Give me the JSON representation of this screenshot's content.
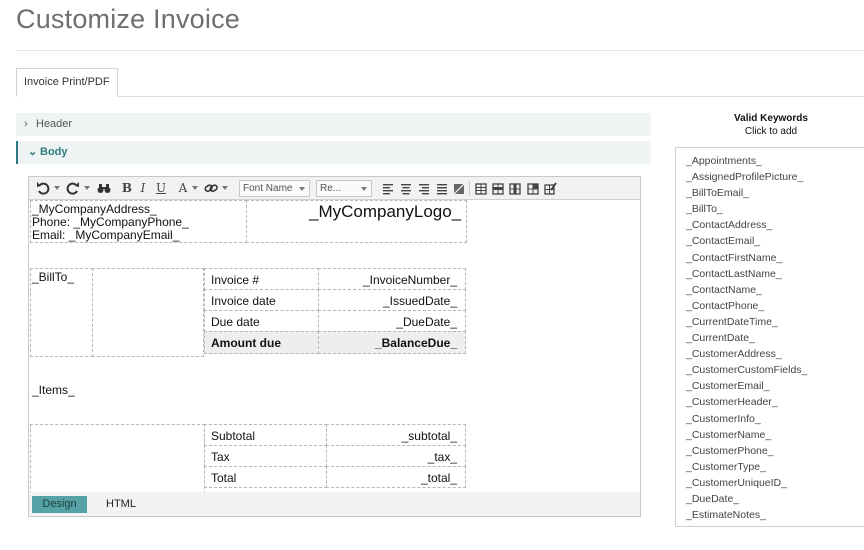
{
  "page": {
    "title": "Customize Invoice"
  },
  "tabs": [
    {
      "label": "Invoice Print/PDF"
    }
  ],
  "sections": {
    "header": "Header",
    "body": "Body"
  },
  "toolbar": {
    "font_name": "Font Name",
    "font_size": "Re..."
  },
  "template": {
    "company_block": [
      "_MyCompanyAddress_",
      "Phone: _MyCompanyPhone_",
      "Email: _MyCompanyEmail_"
    ],
    "logo": "_MyCompanyLogo_",
    "bill_to": "_BillTo_",
    "invoice_rows": [
      {
        "label": "Invoice #",
        "value": "_InvoiceNumber_"
      },
      {
        "label": "Invoice date",
        "value": "_IssuedDate_"
      },
      {
        "label": "Due date",
        "value": "_DueDate_"
      },
      {
        "label": "Amount due",
        "value": "_BalanceDue_"
      }
    ],
    "items": "_Items_",
    "totals_rows": [
      {
        "label": "Subtotal",
        "value": "_subtotal_"
      },
      {
        "label": "Tax",
        "value": "_tax_"
      },
      {
        "label": "Total",
        "value": "_total_"
      }
    ]
  },
  "editor_tabs": {
    "design": "Design",
    "html": "HTML"
  },
  "keywords": {
    "title": "Valid Keywords",
    "subtitle": "Click to add",
    "items": [
      "_Appointments_",
      "_AssignedProfilePicture_",
      "_BillToEmail_",
      "_BillTo_",
      "_ContactAddress_",
      "_ContactEmail_",
      "_ContactFirstName_",
      "_ContactLastName_",
      "_ContactName_",
      "_ContactPhone_",
      "_CurrentDateTime_",
      "_CurrentDate_",
      "_CustomerAddress_",
      "_CustomerCustomFields_",
      "_CustomerEmail_",
      "_CustomerHeader_",
      "_CustomerInfo_",
      "_CustomerName_",
      "_CustomerPhone_",
      "_CustomerType_",
      "_CustomerUniqueID_",
      "_DueDate_",
      "_EstimateNotes_"
    ]
  }
}
